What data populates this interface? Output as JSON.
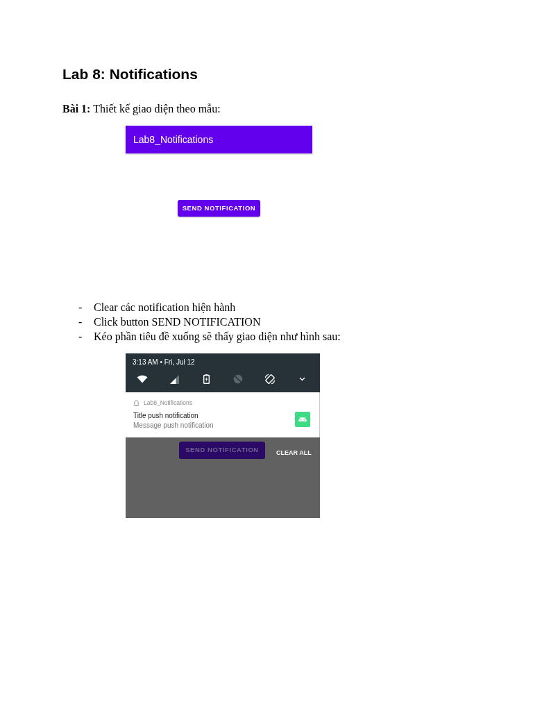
{
  "title": "Lab 8: Notifications",
  "intro": "**Bài 1:** Thiết kế giao diện theo mẫu:",
  "app_mockup": {
    "app_bar_title": "Lab8_Notifications",
    "button": "SEND NOTIFICATION"
  },
  "steps": [
    {
      "marker": "-",
      "text": "Clear các notification hiện hành"
    },
    {
      "marker": "-",
      "text": "Click button SEND NOTIFICATION"
    },
    {
      "marker": "-",
      "text": "Kéo phần tiêu đề xuống sẽ thấy giao diện như hình sau:"
    }
  ],
  "shade_mockup": {
    "status": "3:13 AM • Fri, Jul 12",
    "quick_settings": [
      {
        "kind": "wifi",
        "on": true
      },
      {
        "kind": "signal",
        "on": true
      },
      {
        "kind": "battery",
        "on": true
      },
      {
        "kind": "dnd",
        "on": false
      },
      {
        "kind": "rotate",
        "on": true
      }
    ],
    "notification": {
      "app_name": "Lab8_Notifications",
      "title": "Title push notification",
      "message": "Message push notification"
    },
    "button": "SEND NOTIFICATION",
    "clear_all": "CLEAR ALL"
  }
}
